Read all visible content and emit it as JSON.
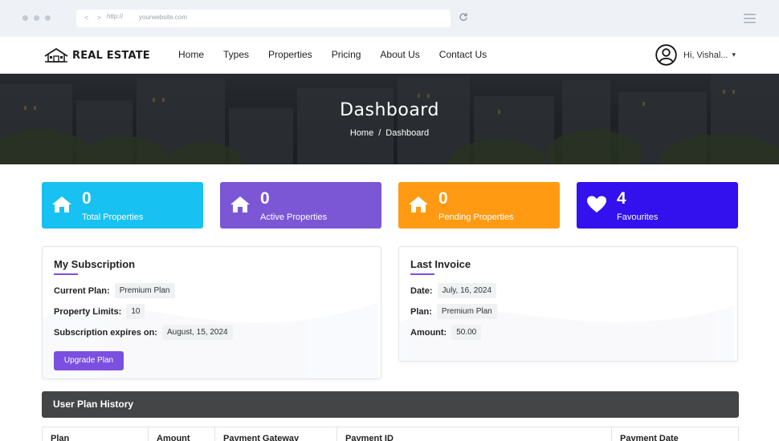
{
  "browser": {
    "nav_arrows": "< >",
    "url_scheme": "http://",
    "url": "yourwebsite.com",
    "reload_icon": "reload-icon",
    "menu_icon": "hamburger-icon"
  },
  "header": {
    "logo_text": "REAL ESTATE",
    "nav": [
      "Home",
      "Types",
      "Properties",
      "Pricing",
      "About Us",
      "Contact Us"
    ],
    "user_greeting": "Hi, Vishal...",
    "caret": "▾"
  },
  "hero": {
    "title": "Dashboard",
    "breadcrumb": [
      "Home",
      "Dashboard"
    ],
    "separator": "/"
  },
  "stats": [
    {
      "value": "0",
      "label": "Total Properties",
      "color": "#17c1f2",
      "icon": "home-icon"
    },
    {
      "value": "0",
      "label": "Active Properties",
      "color": "#7b57d6",
      "icon": "home-icon"
    },
    {
      "value": "0",
      "label": "Pending Properties",
      "color": "#ff9a12",
      "icon": "home-icon"
    },
    {
      "value": "4",
      "label": "Favourites",
      "color": "#3211ee",
      "icon": "heart-icon"
    }
  ],
  "subscription": {
    "title": "My Subscription",
    "current_plan_label": "Current Plan:",
    "current_plan_value": "Premium Plan",
    "limits_label": "Property Limits:",
    "limits_value": "10",
    "expires_label": "Subscription expires on:",
    "expires_value": "August, 15, 2024",
    "upgrade_label": "Upgrade Plan"
  },
  "invoice": {
    "title": "Last Invoice",
    "date_label": "Date:",
    "date_value": "July, 16, 2024",
    "plan_label": "Plan:",
    "plan_value": "Premium Plan",
    "amount_label": "Amount:",
    "amount_value": "50.00"
  },
  "history": {
    "title": "User Plan History",
    "columns": [
      "Plan",
      "Amount",
      "Payment Gateway",
      "Payment ID",
      "Payment Date"
    ]
  },
  "colors": {
    "accent": "#7b4fe0",
    "dark_bar": "#444546"
  }
}
